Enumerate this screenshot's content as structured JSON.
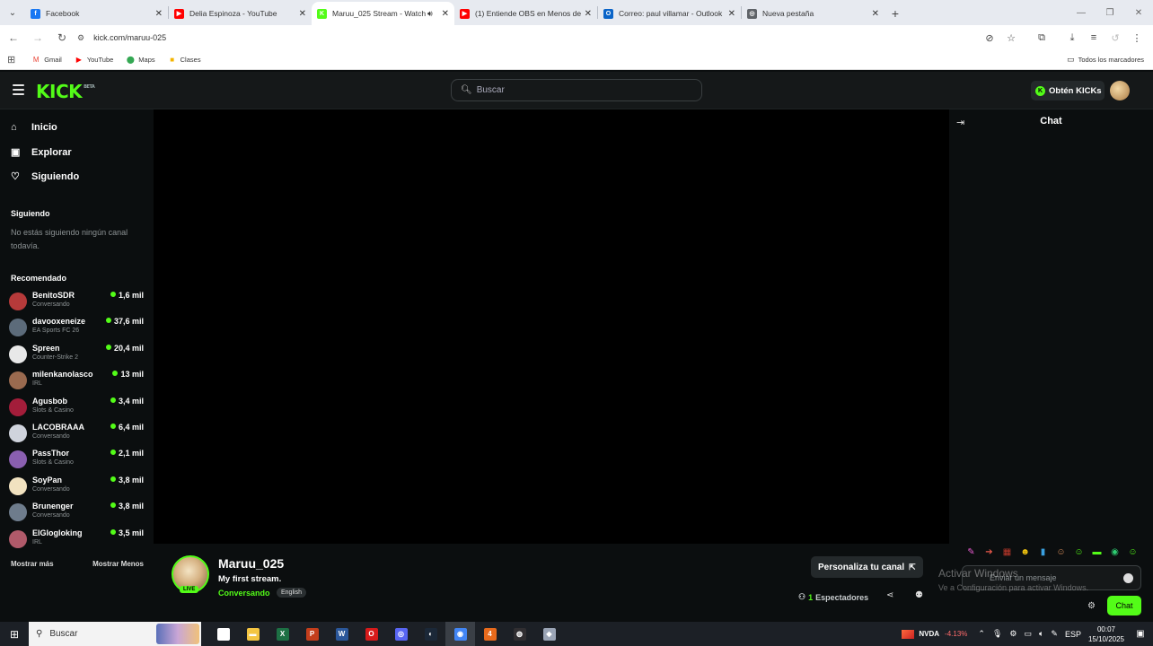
{
  "browser": {
    "tabs": [
      {
        "title": "Facebook",
        "favicon_color": "#1877f2",
        "favicon_glyph": "f",
        "active": false
      },
      {
        "title": "Delia Espinoza - YouTube",
        "favicon_color": "#ff0000",
        "favicon_glyph": "▶",
        "active": false
      },
      {
        "title": "Maruu_025 Stream - Watch",
        "favicon_color": "#53fc18",
        "favicon_glyph": "K",
        "active": true
      },
      {
        "title": "(1) Entiende OBS en Menos de",
        "favicon_color": "#ff0000",
        "favicon_glyph": "▶",
        "active": false
      },
      {
        "title": "Correo: paul villamar - Outlook",
        "favicon_color": "#0a64c8",
        "favicon_glyph": "O",
        "active": false
      },
      {
        "title": "Nueva pestaña",
        "favicon_color": "#5f6368",
        "favicon_glyph": "◎",
        "active": false
      }
    ],
    "url": "kick.com/maruu-025",
    "bookmarks": [
      {
        "label": "Gmail",
        "icon": "gmail-icon",
        "glyph": "M",
        "color": "#ea4335"
      },
      {
        "label": "YouTube",
        "icon": "youtube-icon",
        "glyph": "▶",
        "color": "#ff0000"
      },
      {
        "label": "Maps",
        "icon": "maps-icon",
        "glyph": "⬤",
        "color": "#34a853"
      },
      {
        "label": "Clases",
        "icon": "classroom-icon",
        "glyph": "■",
        "color": "#f4b400"
      }
    ],
    "all_bookmarks_label": "Todos los marcadores"
  },
  "kick": {
    "logo_text": "KICK",
    "logo_sup": "BETA",
    "search_placeholder": "Buscar",
    "kicks_button": "Obtén KICKs",
    "nav": [
      {
        "label": "Inicio",
        "icon": "home-icon",
        "glyph": "⌂"
      },
      {
        "label": "Explorar",
        "icon": "compass-icon",
        "glyph": "▣"
      },
      {
        "label": "Siguiendo",
        "icon": "heart-icon",
        "glyph": "♡"
      }
    ],
    "following_heading": "Siguiendo",
    "following_empty": "No estás siguiendo ningún canal todavía.",
    "recommended_heading": "Recomendado",
    "recommended": [
      {
        "name": "BenitoSDR",
        "category": "Conversando",
        "viewers": "1,6 mil",
        "avatar_color": "#b63a3a"
      },
      {
        "name": "davooxeneize",
        "category": "EA Sports FC 26",
        "viewers": "37,6 mil",
        "avatar_color": "#5c6b7a"
      },
      {
        "name": "Spreen",
        "category": "Counter-Strike 2",
        "viewers": "20,4 mil",
        "avatar_color": "#e8e8e8"
      },
      {
        "name": "milenkanolasco",
        "category": "IRL",
        "viewers": "13 mil",
        "avatar_color": "#9a6a4f"
      },
      {
        "name": "Agusbob",
        "category": "Slots & Casino",
        "viewers": "3,4 mil",
        "avatar_color": "#a31d3a"
      },
      {
        "name": "LACOBRAAA",
        "category": "Conversando",
        "viewers": "6,4 mil",
        "avatar_color": "#cfd3dc"
      },
      {
        "name": "PassThor",
        "category": "Slots & Casino",
        "viewers": "2,1 mil",
        "avatar_color": "#8a5fb0"
      },
      {
        "name": "SoyPan",
        "category": "Conversando",
        "viewers": "3,8 mil",
        "avatar_color": "#f1e2c0"
      },
      {
        "name": "Brunenger",
        "category": "Conversando",
        "viewers": "3,8 mil",
        "avatar_color": "#6e7c8c"
      },
      {
        "name": "ElGlogloking",
        "category": "IRL",
        "viewers": "3,5 mil",
        "avatar_color": "#b05a6a"
      }
    ],
    "show_more": "Mostrar más",
    "show_less": "Mostrar Menos",
    "stream": {
      "live_label": "LIVE",
      "channel_name": "Maruu_025",
      "title": "My first stream.",
      "category": "Conversando",
      "language": "English",
      "customize_button": "Personaliza tu canal",
      "viewer_count": "1",
      "viewers_label": "Espectadores"
    },
    "chat": {
      "title": "Chat",
      "input_placeholder": "Enviar un mensaje",
      "send_button": "Chat",
      "emotes": [
        {
          "glyph": "✎",
          "color": "#e85bd0"
        },
        {
          "glyph": "➔",
          "color": "#e8584a"
        },
        {
          "glyph": "▦",
          "color": "#c0392b"
        },
        {
          "glyph": "☻",
          "color": "#f1c40f"
        },
        {
          "glyph": "▮",
          "color": "#3aa0e0"
        },
        {
          "glyph": "☺",
          "color": "#d98e5a"
        },
        {
          "glyph": "☺",
          "color": "#53fc18"
        },
        {
          "glyph": "▬",
          "color": "#53fc18"
        },
        {
          "glyph": "◉",
          "color": "#2ecc71"
        },
        {
          "glyph": "☺",
          "color": "#53fc18"
        }
      ]
    }
  },
  "windows": {
    "activate_title": "Activar Windows",
    "activate_sub": "Ve a Configuración para activar Windows.",
    "search_placeholder": "Buscar",
    "taskbar_apps": [
      {
        "name": "task-view",
        "glyph": "⧉",
        "color": "#ffffff",
        "active": false
      },
      {
        "name": "file-explorer",
        "glyph": "▬",
        "color": "#f4c542",
        "active": false
      },
      {
        "name": "excel",
        "glyph": "X",
        "color": "#1d7044",
        "active": false
      },
      {
        "name": "powerpoint",
        "glyph": "P",
        "color": "#c43e1c",
        "active": false
      },
      {
        "name": "word",
        "glyph": "W",
        "color": "#2b579a",
        "active": false
      },
      {
        "name": "opera",
        "glyph": "O",
        "color": "#d61b1b",
        "active": false
      },
      {
        "name": "discord-app",
        "glyph": "◎",
        "color": "#5865f2",
        "active": false
      },
      {
        "name": "steam",
        "glyph": "◐",
        "color": "#1b2838",
        "active": false
      },
      {
        "name": "chrome",
        "glyph": "◉",
        "color": "#4285f4",
        "active": true
      },
      {
        "name": "office-app",
        "glyph": "4",
        "color": "#e86a1c",
        "active": false
      },
      {
        "name": "obs",
        "glyph": "◍",
        "color": "#302e31",
        "active": false
      },
      {
        "name": "game-app",
        "glyph": "◆",
        "color": "#9aa4b5",
        "active": false
      }
    ],
    "stock_name": "NVDA",
    "stock_change": "-4.13%",
    "language": "ESP",
    "time": "00:07",
    "date": "15/10/2025"
  }
}
